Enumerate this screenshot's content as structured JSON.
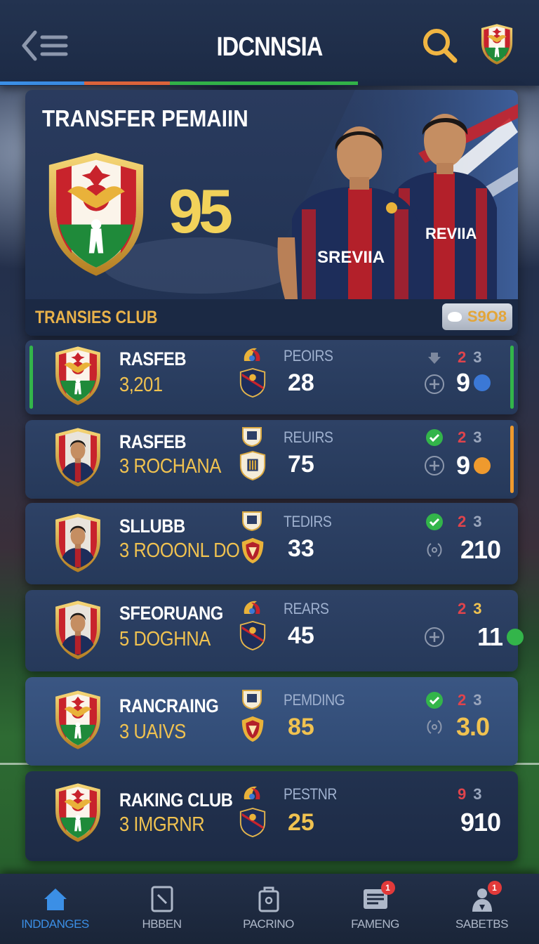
{
  "header": {
    "title": "IDCNNSIA",
    "menu_icon": "back-menu-icon",
    "search_icon": "search-icon",
    "logo_icon": "club-crest-icon"
  },
  "colors": {
    "accent_blue": "#3b8fe6",
    "accent_red": "#e0444c",
    "accent_green": "#33b54a",
    "accent_gold": "#f0c250",
    "accent_orange": "#ef9a2e"
  },
  "hero": {
    "title": "TRANSFER PEMAIIN",
    "rating": "95",
    "jersey_text": "SREVIIA",
    "jersey_text_2": "REVIIA",
    "sub_label": "TRANSIES CLUB",
    "coin_value": "S9O8"
  },
  "rows": [
    {
      "name": "RASFEB",
      "sub": "3,201",
      "stat_label": "PEOIRS",
      "stat_value": "28",
      "count_a": "2",
      "count_b": "3",
      "trailing": "9",
      "dot_color": "#3b78d6",
      "avatar": "club-crest",
      "left_accent": "#33b54a",
      "right_accent": "#33b54a",
      "status": "download-icon",
      "action": "plus-icon"
    },
    {
      "name": "RASFEB",
      "sub": "3 ROCHANA",
      "stat_label": "REUIRS",
      "stat_value": "75",
      "count_a": "2",
      "count_b": "3",
      "trailing": "9",
      "dot_color": "#ef9a2e",
      "avatar": "player-portrait",
      "right_accent": "#ef9a2e",
      "status": "check-icon",
      "action": "plus-icon"
    },
    {
      "name": "SLLUBB",
      "sub": "3 ROOONL DO",
      "stat_label": "TEDIRS",
      "stat_value": "33",
      "count_a": "2",
      "count_b": "3",
      "trailing": "210",
      "avatar": "player-portrait",
      "status": "check-icon",
      "action": "swap-icon"
    },
    {
      "name": "SFEORUANG",
      "sub": "5 DOGHNA",
      "stat_label": "REARS",
      "stat_value": "45",
      "count_a": "2",
      "count_b": "3",
      "trailing": "11",
      "dot_color": "#33b54a",
      "avatar": "player-portrait",
      "action": "plus-icon"
    },
    {
      "name": "RANCRAING",
      "sub": "3 UAIVS",
      "stat_label": "PEMDING",
      "stat_value": "85",
      "count_a": "2",
      "count_b": "3",
      "trailing": "3.0",
      "avatar": "club-crest",
      "status": "check-icon",
      "action": "swap-icon"
    },
    {
      "name": "RAKING CLUB",
      "sub": "3 IMGRNR",
      "stat_label": "PESTNR",
      "stat_value": "25",
      "count_a": "9",
      "count_b": "3",
      "trailing": "910",
      "avatar": "club-crest"
    }
  ],
  "bottom_nav": [
    {
      "label": "INDDANGES",
      "icon": "home-icon",
      "active": true
    },
    {
      "label": "HBBEN",
      "icon": "tablet-icon",
      "active": false
    },
    {
      "label": "PACRINO",
      "icon": "bag-icon",
      "active": false
    },
    {
      "label": "FAMENG",
      "icon": "news-icon",
      "active": false,
      "badge": "1"
    },
    {
      "label": "SABETBS",
      "icon": "profile-icon",
      "active": false,
      "badge": "1"
    }
  ]
}
